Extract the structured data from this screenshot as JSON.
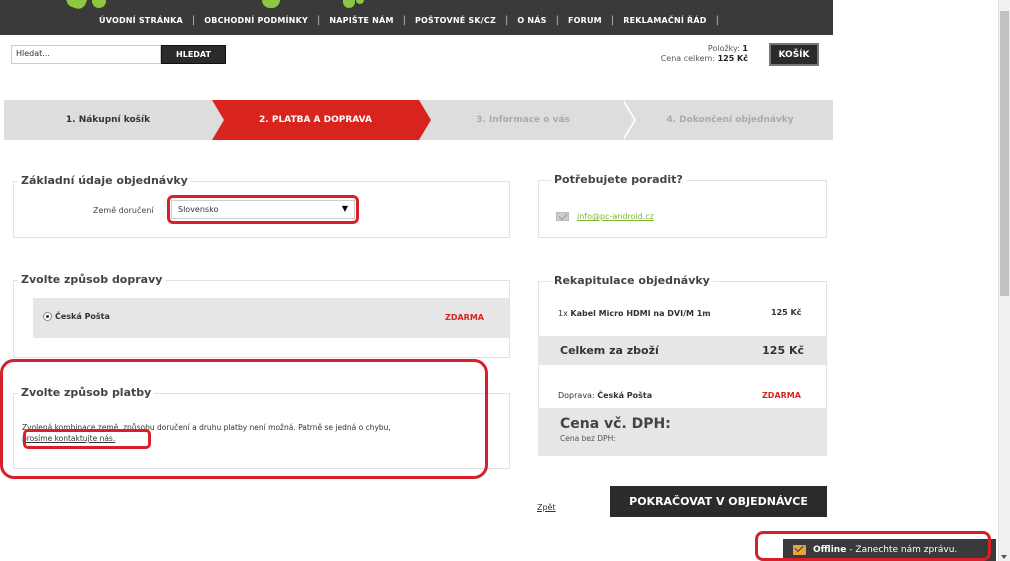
{
  "nav": {
    "items": [
      "ÚVODNÍ STRÁNKA",
      "OBCHODNÍ PODMÍNKY",
      "NAPIŠTE NÁM",
      "POŠTOVNÉ SK/CZ",
      "O NÁS",
      "FORUM",
      "REKLAMAČNÍ ŘÁD"
    ]
  },
  "search": {
    "value": "Hledat...",
    "button": "HLEDAT"
  },
  "cart": {
    "items_label": "Položky:",
    "items_count": "1",
    "total_label": "Cena celkem:",
    "total_value": "125 Kč",
    "button": "KOŠÍK"
  },
  "steps": [
    "1. Nákupní košík",
    "2. PLATBA A DOPRAVA",
    "3. Informace o vás",
    "4. Dokončení objednávky"
  ],
  "order_basics": {
    "title": "Základní údaje objednávky",
    "country_label": "Země doručení",
    "country_value": "Slovensko"
  },
  "shipping": {
    "title": "Zvolte způsob dopravy",
    "option": "Česká Pošta",
    "price": "ZDARMA"
  },
  "payment": {
    "title": "Zvolte způsob platby",
    "message": "Zvolená kombinace země, způsobu doručení a druhu platby není možná. Patrně se jedná o chybu,",
    "message_link": "prosíme kontaktujte nás."
  },
  "help": {
    "title": "Potřebujete poradit?",
    "email": "info@pc-android.cz"
  },
  "recap": {
    "title": "Rekapitulace objednávky",
    "item_qty": "1x",
    "item_name": "Kabel Micro HDMI na DVI/M 1m",
    "item_price": "125 Kč",
    "total_label": "Celkem za zboží",
    "total_value": "125 Kč",
    "shipping_label": "Doprava:",
    "shipping_name": "Česká Pošta",
    "shipping_price": "ZDARMA",
    "vat_title": "Cena vč. DPH:",
    "vat_sub": "Cena bez DPH:"
  },
  "actions": {
    "back": "Zpět",
    "continue": "POKRAČOVAT V OBJEDNÁVCE"
  },
  "chat": {
    "status": "Offline",
    "message": " - Zanechte nám zprávu."
  },
  "colors": {
    "accent": "#d9231d",
    "dark": "#2b2b2b",
    "green": "#8dc63f",
    "annotation": "#d8202a"
  }
}
